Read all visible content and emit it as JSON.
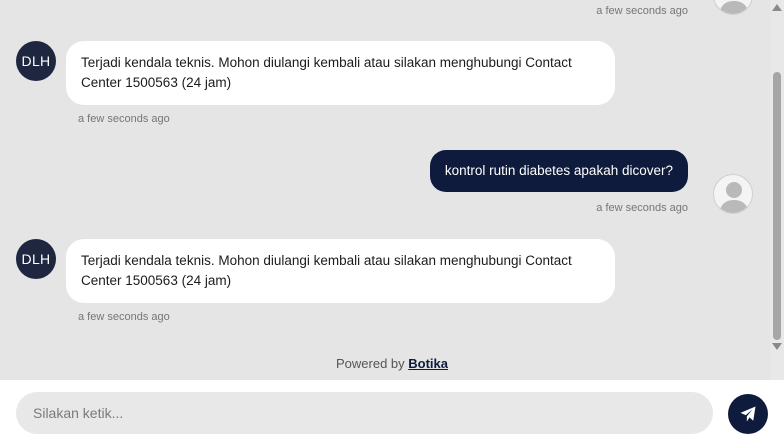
{
  "messages": [
    {
      "role": "user",
      "text": "",
      "time": "a few seconds ago"
    },
    {
      "role": "bot",
      "avatar": "DLH",
      "text": "Terjadi kendala teknis. Mohon diulangi kembali atau silakan menghubungi Contact Center 1500563 (24 jam)",
      "time": "a few seconds ago"
    },
    {
      "role": "user",
      "text": "kontrol rutin diabetes apakah dicover?",
      "time": "a few seconds ago"
    },
    {
      "role": "bot",
      "avatar": "DLH",
      "text": "Terjadi kendala teknis. Mohon diulangi kembali atau silakan menghubungi Contact Center 1500563 (24 jam)",
      "time": "a few seconds ago"
    }
  ],
  "footer": {
    "powered_prefix": "Powered by",
    "powered_brand": "Botika"
  },
  "composer": {
    "placeholder": "Silakan ketik...",
    "send_icon": "paper-plane-icon"
  },
  "colors": {
    "accent": "#0e1b3c",
    "bot_avatar": "#1f2640",
    "background": "#e5e5e5"
  }
}
